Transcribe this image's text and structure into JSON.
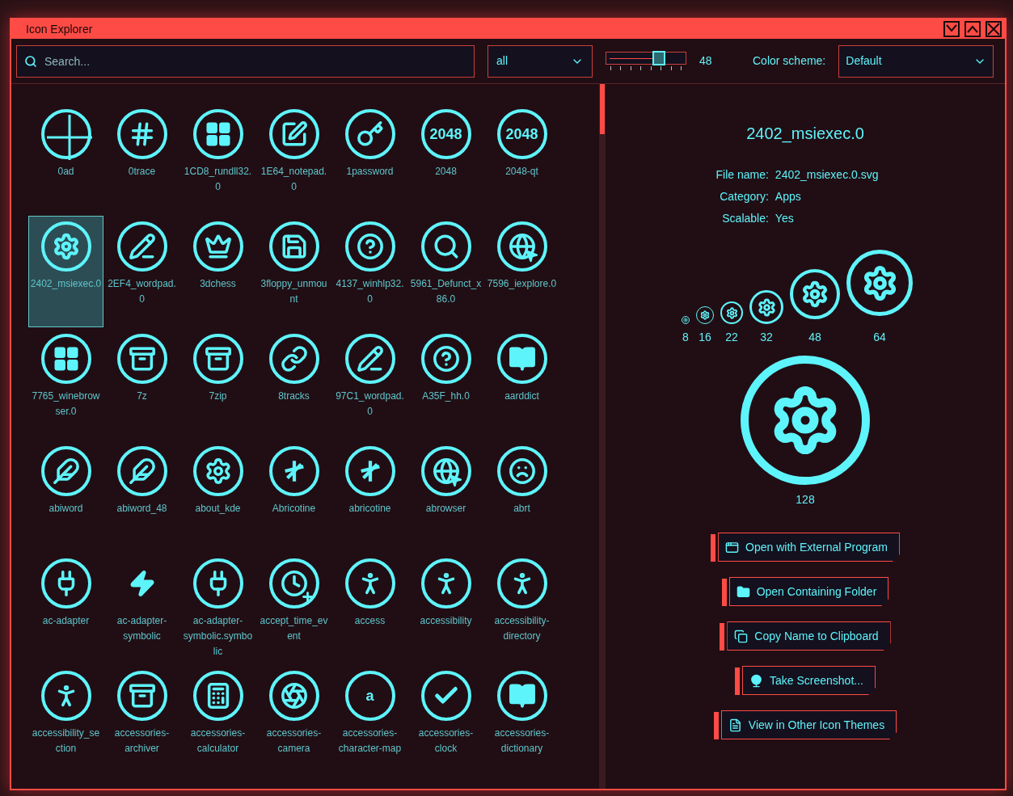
{
  "window": {
    "title": "Icon Explorer"
  },
  "toolbar": {
    "search": {
      "placeholder": "Search..."
    },
    "filter": {
      "value": "all"
    },
    "size_slider": {
      "level": 0.66
    },
    "size_reading": "48",
    "color_scheme": {
      "label": "Color scheme:",
      "value": "Default"
    }
  },
  "icons": [
    {
      "name": "0ad",
      "kind": "crosshair",
      "selected": false
    },
    {
      "name": "0trace",
      "kind": "hash",
      "selected": false
    },
    {
      "name": "1CD8_rundll32.0",
      "kind": "windows",
      "selected": false
    },
    {
      "name": "1E64_notepad.0",
      "kind": "notepad",
      "selected": false
    },
    {
      "name": "1password",
      "kind": "key",
      "selected": false
    },
    {
      "name": "2048",
      "kind": "text",
      "icon_text": "2048",
      "selected": false
    },
    {
      "name": "2048-qt",
      "kind": "text",
      "icon_text": "2048",
      "selected": false
    },
    {
      "name": "2402_msiexec.0",
      "kind": "gear",
      "selected": true
    },
    {
      "name": "2EF4_wordpad.0",
      "kind": "wordpad",
      "selected": false
    },
    {
      "name": "3dchess",
      "kind": "chess",
      "selected": false
    },
    {
      "name": "3floppy_unmount",
      "kind": "floppy",
      "selected": false
    },
    {
      "name": "4137_winhlp32.0",
      "kind": "help",
      "selected": false
    },
    {
      "name": "5961_Defunct_x86.0",
      "kind": "search",
      "selected": false
    },
    {
      "name": "7596_iexplore.0",
      "kind": "globe",
      "selected": false
    },
    {
      "name": "7765_winebrowser.0",
      "kind": "windows",
      "selected": false
    },
    {
      "name": "7z",
      "kind": "zip",
      "selected": false
    },
    {
      "name": "7zip",
      "kind": "zip",
      "selected": false
    },
    {
      "name": "8tracks",
      "kind": "link",
      "selected": false
    },
    {
      "name": "97C1_wordpad.0",
      "kind": "wordpad",
      "selected": false
    },
    {
      "name": "A35F_hh.0",
      "kind": "help",
      "selected": false
    },
    {
      "name": "aarddict",
      "kind": "book",
      "selected": false
    },
    {
      "name": "abiword",
      "kind": "abiword",
      "selected": false
    },
    {
      "name": "abiword_48",
      "kind": "abiword",
      "selected": false
    },
    {
      "name": "about_kde",
      "kind": "kde",
      "selected": false
    },
    {
      "name": "Abricotine",
      "kind": "abricotine",
      "selected": false
    },
    {
      "name": "abricotine",
      "kind": "abricotine",
      "selected": false
    },
    {
      "name": "abrowser",
      "kind": "globe",
      "selected": false
    },
    {
      "name": "abrt",
      "kind": "face",
      "selected": false
    },
    {
      "name": "ac-adapter",
      "kind": "adapter",
      "selected": false
    },
    {
      "name": "ac-adapter-symbolic",
      "kind": "bolt",
      "selected": false
    },
    {
      "name": "ac-adapter-symbolic.symbolic",
      "kind": "adapter",
      "selected": false
    },
    {
      "name": "accept_time_event",
      "kind": "clock",
      "selected": false
    },
    {
      "name": "access",
      "kind": "person",
      "selected": false
    },
    {
      "name": "accessibility",
      "kind": "person",
      "selected": false
    },
    {
      "name": "accessibility-directory",
      "kind": "person",
      "selected": false
    },
    {
      "name": "accessibility_section",
      "kind": "person",
      "selected": false
    },
    {
      "name": "accessories-archiver",
      "kind": "zip",
      "selected": false
    },
    {
      "name": "accessories-calculator",
      "kind": "calculator",
      "selected": false
    },
    {
      "name": "accessories-camera",
      "kind": "aperture",
      "selected": false
    },
    {
      "name": "accessories-character-map",
      "kind": "text",
      "icon_text": "a",
      "selected": false
    },
    {
      "name": "accessories-clock",
      "kind": "check",
      "selected": false
    },
    {
      "name": "accessories-dictionary",
      "kind": "book",
      "selected": false
    }
  ],
  "details": {
    "title": "2402_msiexec.0",
    "fields": [
      {
        "label": "File name:",
        "value": "2402_msiexec.0.svg"
      },
      {
        "label": "Category:",
        "value": "Apps"
      },
      {
        "label": "Scalable:",
        "value": "Yes"
      }
    ],
    "sizes": [
      "8",
      "16",
      "22",
      "32",
      "48",
      "64"
    ],
    "large_size": "128"
  },
  "actions": [
    {
      "label": "Open with External Program",
      "kind": "window"
    },
    {
      "label": "Open Containing Folder",
      "kind": "folder"
    },
    {
      "label": "Copy Name to Clipboard",
      "kind": "copy"
    },
    {
      "label": "Take Screenshot...",
      "kind": "camera"
    },
    {
      "label": "View in Other Icon Themes",
      "kind": "document"
    }
  ]
}
